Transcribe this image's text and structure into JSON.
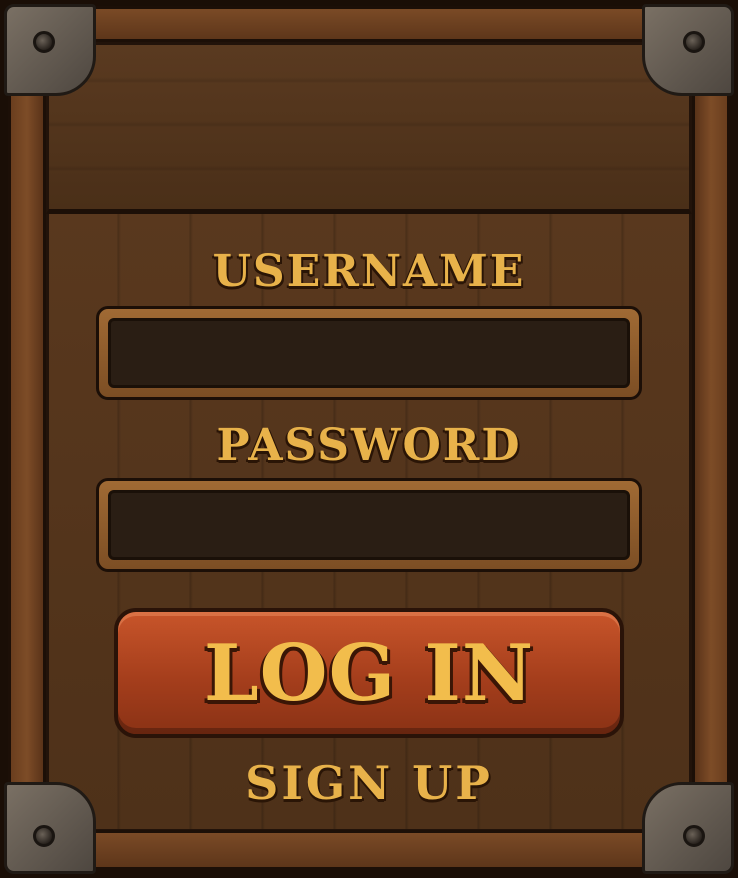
{
  "login_panel": {
    "username_label": "USERNAME",
    "username_value": "",
    "password_label": "PASSWORD",
    "password_value": "",
    "login_button_label": "LOG IN",
    "signup_link_label": "SIGN UP"
  },
  "icons": {
    "corner_bolts": "bolt-icon"
  },
  "colors": {
    "label_gold": "#e8b24a",
    "button_orange": "#b8481f",
    "wood_dark": "#4e3119",
    "field_fill": "#2a1e14"
  }
}
